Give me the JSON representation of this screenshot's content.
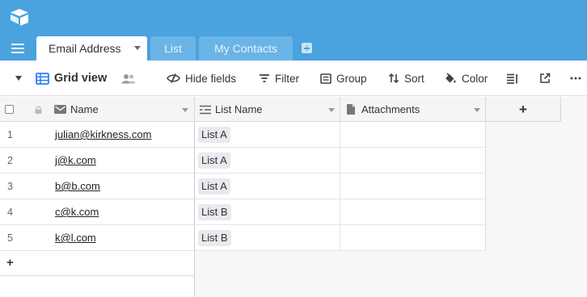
{
  "header": {
    "logo_icon": "airtable-logo-icon"
  },
  "tabs": {
    "active": "Email Address",
    "items": [
      "List",
      "My Contacts"
    ]
  },
  "toolbar": {
    "view_label": "Grid view",
    "hide_fields": "Hide fields",
    "filter": "Filter",
    "group": "Group",
    "sort": "Sort",
    "color": "Color"
  },
  "columns": {
    "name": "Name",
    "list_name": "List Name",
    "attachments": "Attachments",
    "add": "+"
  },
  "rows": [
    {
      "num": "1",
      "email": "julian@kirkness.com",
      "list": "List A"
    },
    {
      "num": "2",
      "email": "j@k.com",
      "list": "List A"
    },
    {
      "num": "3",
      "email": "b@b.com",
      "list": "List A"
    },
    {
      "num": "4",
      "email": "c@k.com",
      "list": "List B"
    },
    {
      "num": "5",
      "email": "k@l.com",
      "list": "List B"
    }
  ],
  "add_row": "+"
}
